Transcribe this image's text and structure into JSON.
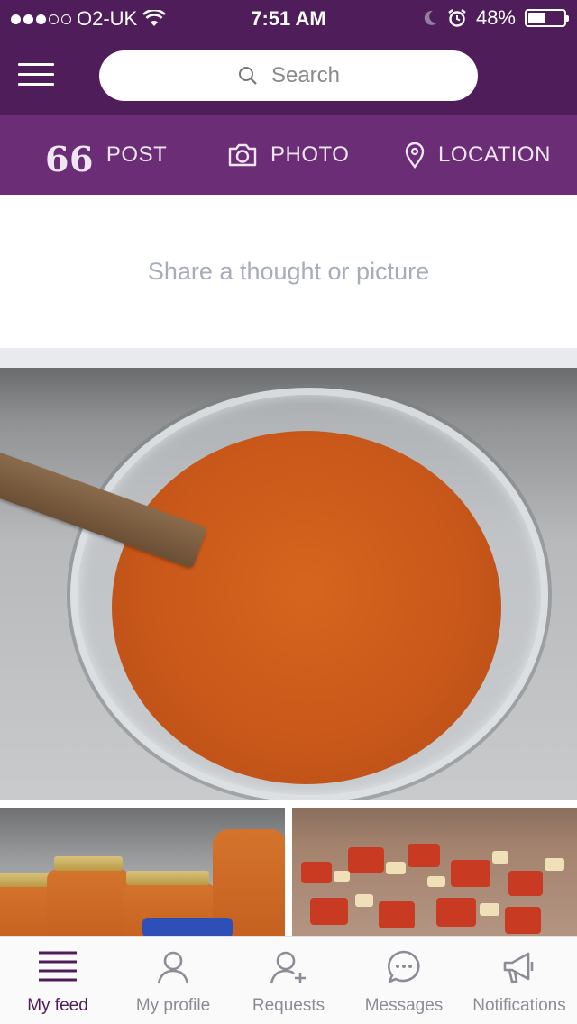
{
  "status_bar": {
    "carrier": "O2-UK",
    "time": "7:51 AM",
    "battery": "48%",
    "battery_level": 0.48,
    "signal_bars": 3,
    "signal_total": 5
  },
  "header": {
    "search_placeholder": "Search",
    "menu_icon": "hamburger-icon",
    "search_icon": "search-icon"
  },
  "actions": [
    {
      "label": "POST",
      "icon": "quote-icon"
    },
    {
      "label": "PHOTO",
      "icon": "camera-icon"
    },
    {
      "label": "LOCATION",
      "icon": "location-pin-icon"
    }
  ],
  "composer": {
    "placeholder": "Share a thought or picture"
  },
  "tabs": [
    {
      "label": "My feed",
      "icon": "feed-icon",
      "active": true
    },
    {
      "label": "My profile",
      "icon": "profile-icon",
      "active": false
    },
    {
      "label": "Requests",
      "icon": "add-user-icon",
      "active": false
    },
    {
      "label": "Messages",
      "icon": "chat-icon",
      "active": false
    },
    {
      "label": "Notifications",
      "icon": "megaphone-icon",
      "active": false
    }
  ],
  "colors": {
    "brand_dark": "#4f1d5a",
    "brand": "#6b2e76",
    "active_tab": "#4f1d5a",
    "inactive_tab": "#8c8c96"
  }
}
